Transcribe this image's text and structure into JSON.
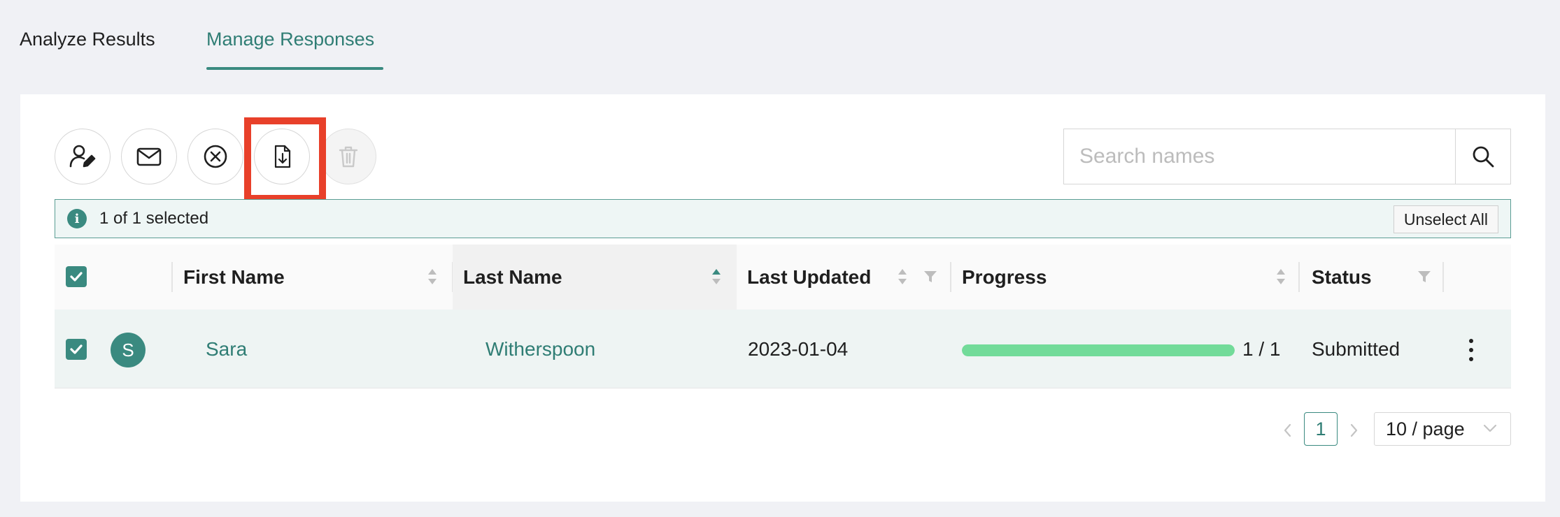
{
  "tabs": [
    {
      "label": "Analyze Results",
      "active": false
    },
    {
      "label": "Manage Responses",
      "active": true
    }
  ],
  "toolbar": {
    "buttons": [
      {
        "icon": "edit-user-icon",
        "enabled": true
      },
      {
        "icon": "mail-icon",
        "enabled": true
      },
      {
        "icon": "close-circle-icon",
        "enabled": true
      },
      {
        "icon": "file-download-icon",
        "enabled": true,
        "highlighted": true
      },
      {
        "icon": "trash-icon",
        "enabled": false
      }
    ]
  },
  "search": {
    "placeholder": "Search names",
    "value": ""
  },
  "selection": {
    "text": "1 of 1 selected",
    "unselect_label": "Unselect All"
  },
  "table": {
    "columns": {
      "first_name": "First Name",
      "last_name": "Last Name",
      "last_updated": "Last Updated",
      "progress": "Progress",
      "status": "Status"
    },
    "sorted_column": "last_name",
    "sort_direction": "ascending",
    "rows": [
      {
        "selected": true,
        "avatar": "S",
        "first_name": "Sara",
        "last_name": "Witherspoon",
        "last_updated": "2023-01-04",
        "progress_text": "1 / 1",
        "progress_fraction": 1.0,
        "status": "Submitted"
      }
    ]
  },
  "pagination": {
    "current_page": "1",
    "page_size": "10 / page"
  },
  "colors": {
    "accent": "#3a8a80",
    "progress": "#72db99",
    "highlight": "#e8402a"
  }
}
